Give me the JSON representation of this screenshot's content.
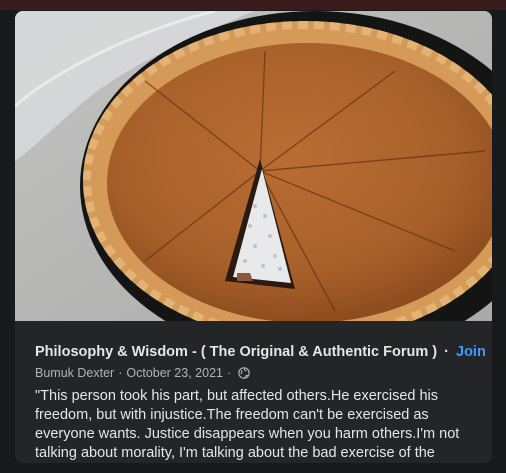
{
  "post": {
    "group_name": "Philosophy & Wisdom - ( The Original & Authentic Forum )",
    "separator": "·",
    "join_label": "Join",
    "author": "Bumuk Dexter",
    "meta_separator": "·",
    "date": "October 23, 2021",
    "meta_trailing_separator": "·",
    "privacy_icon": "globe-icon",
    "text": "\"This person took his part, but affected others.He exercised his freedom, but with injustice.The freedom can't be exercised as everyone wants. Justice disappears when you harm others.I'm not talking about morality, I'm talking about the bad exercise of the freedom\""
  },
  "image": {
    "subject": "pumpkin-pie-photo"
  },
  "colors": {
    "background": "#18191a",
    "card": "#242526",
    "primary_text": "#e4e6eb",
    "secondary_text": "#b0b3b8",
    "link": "#4599ff"
  }
}
